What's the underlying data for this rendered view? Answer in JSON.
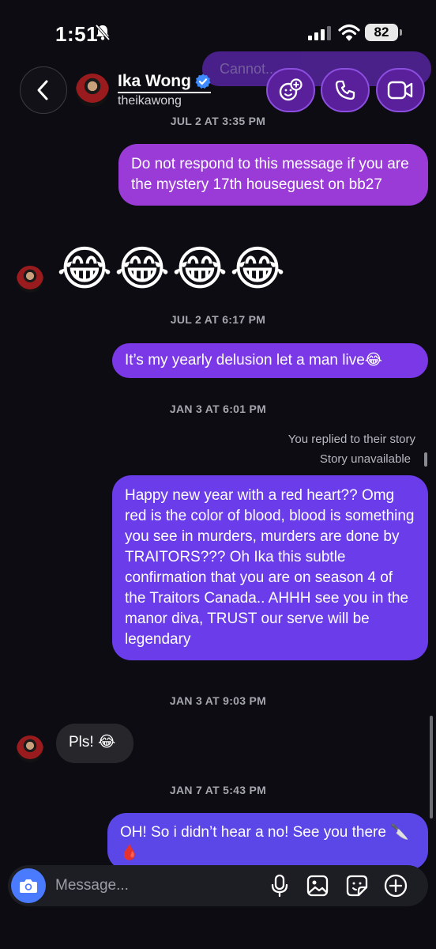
{
  "status_bar": {
    "time": "1:51",
    "battery": "82"
  },
  "ghost_banner": {
    "text": "Cannot..."
  },
  "header": {
    "name": "Ika Wong",
    "handle": "theikawong"
  },
  "messages": {
    "ts1": "JUL 2 AT 3:35 PM",
    "out1": "Do not respond to this message if you are the mystery 17th houseguest on bb27",
    "emoji": [
      "😂",
      "😂",
      "😂",
      "😂"
    ],
    "ts2": "JUL 2 AT 6:17 PM",
    "out2": "It’s my yearly delusion let a man live😂",
    "ts3": "JAN 3 AT 6:01 PM",
    "replied_meta": "You replied to their story",
    "story_unavailable": "Story unavailable",
    "out3": "Happy new year with a red heart?? Omg  red is the color of blood, blood is something you see in murders, murders are done by TRAITORS??? Oh Ika this subtle confirmation that you are on season 4 of the Traitors Canada.. AHHH see you in the manor diva, TRUST our serve will be legendary",
    "ts4": "JAN 3 AT 9:03 PM",
    "in1": "Pls! 😂",
    "ts5": "JAN 7 AT 5:43 PM",
    "out4": "OH! So i didn’t hear a no! See you there 🔪🩸"
  },
  "composer": {
    "placeholder": "Message..."
  },
  "icons": {
    "back": "chevron-left-icon",
    "effects": "face-plus-icon",
    "call": "phone-icon",
    "video": "video-camera-icon",
    "camera": "camera-icon",
    "mic": "microphone-icon",
    "gallery": "image-icon",
    "sticker": "sticker-icon",
    "plus": "plus-circle-icon"
  },
  "colors": {
    "accent_blue": "#4a7bff",
    "bubble_purple_1": "#9a3bd8",
    "bubble_purple_2": "#7a38e6",
    "bubble_purple_3": "#6a3cea",
    "bubble_indigo": "#5b46e8",
    "incoming_bubble": "#26262b"
  }
}
